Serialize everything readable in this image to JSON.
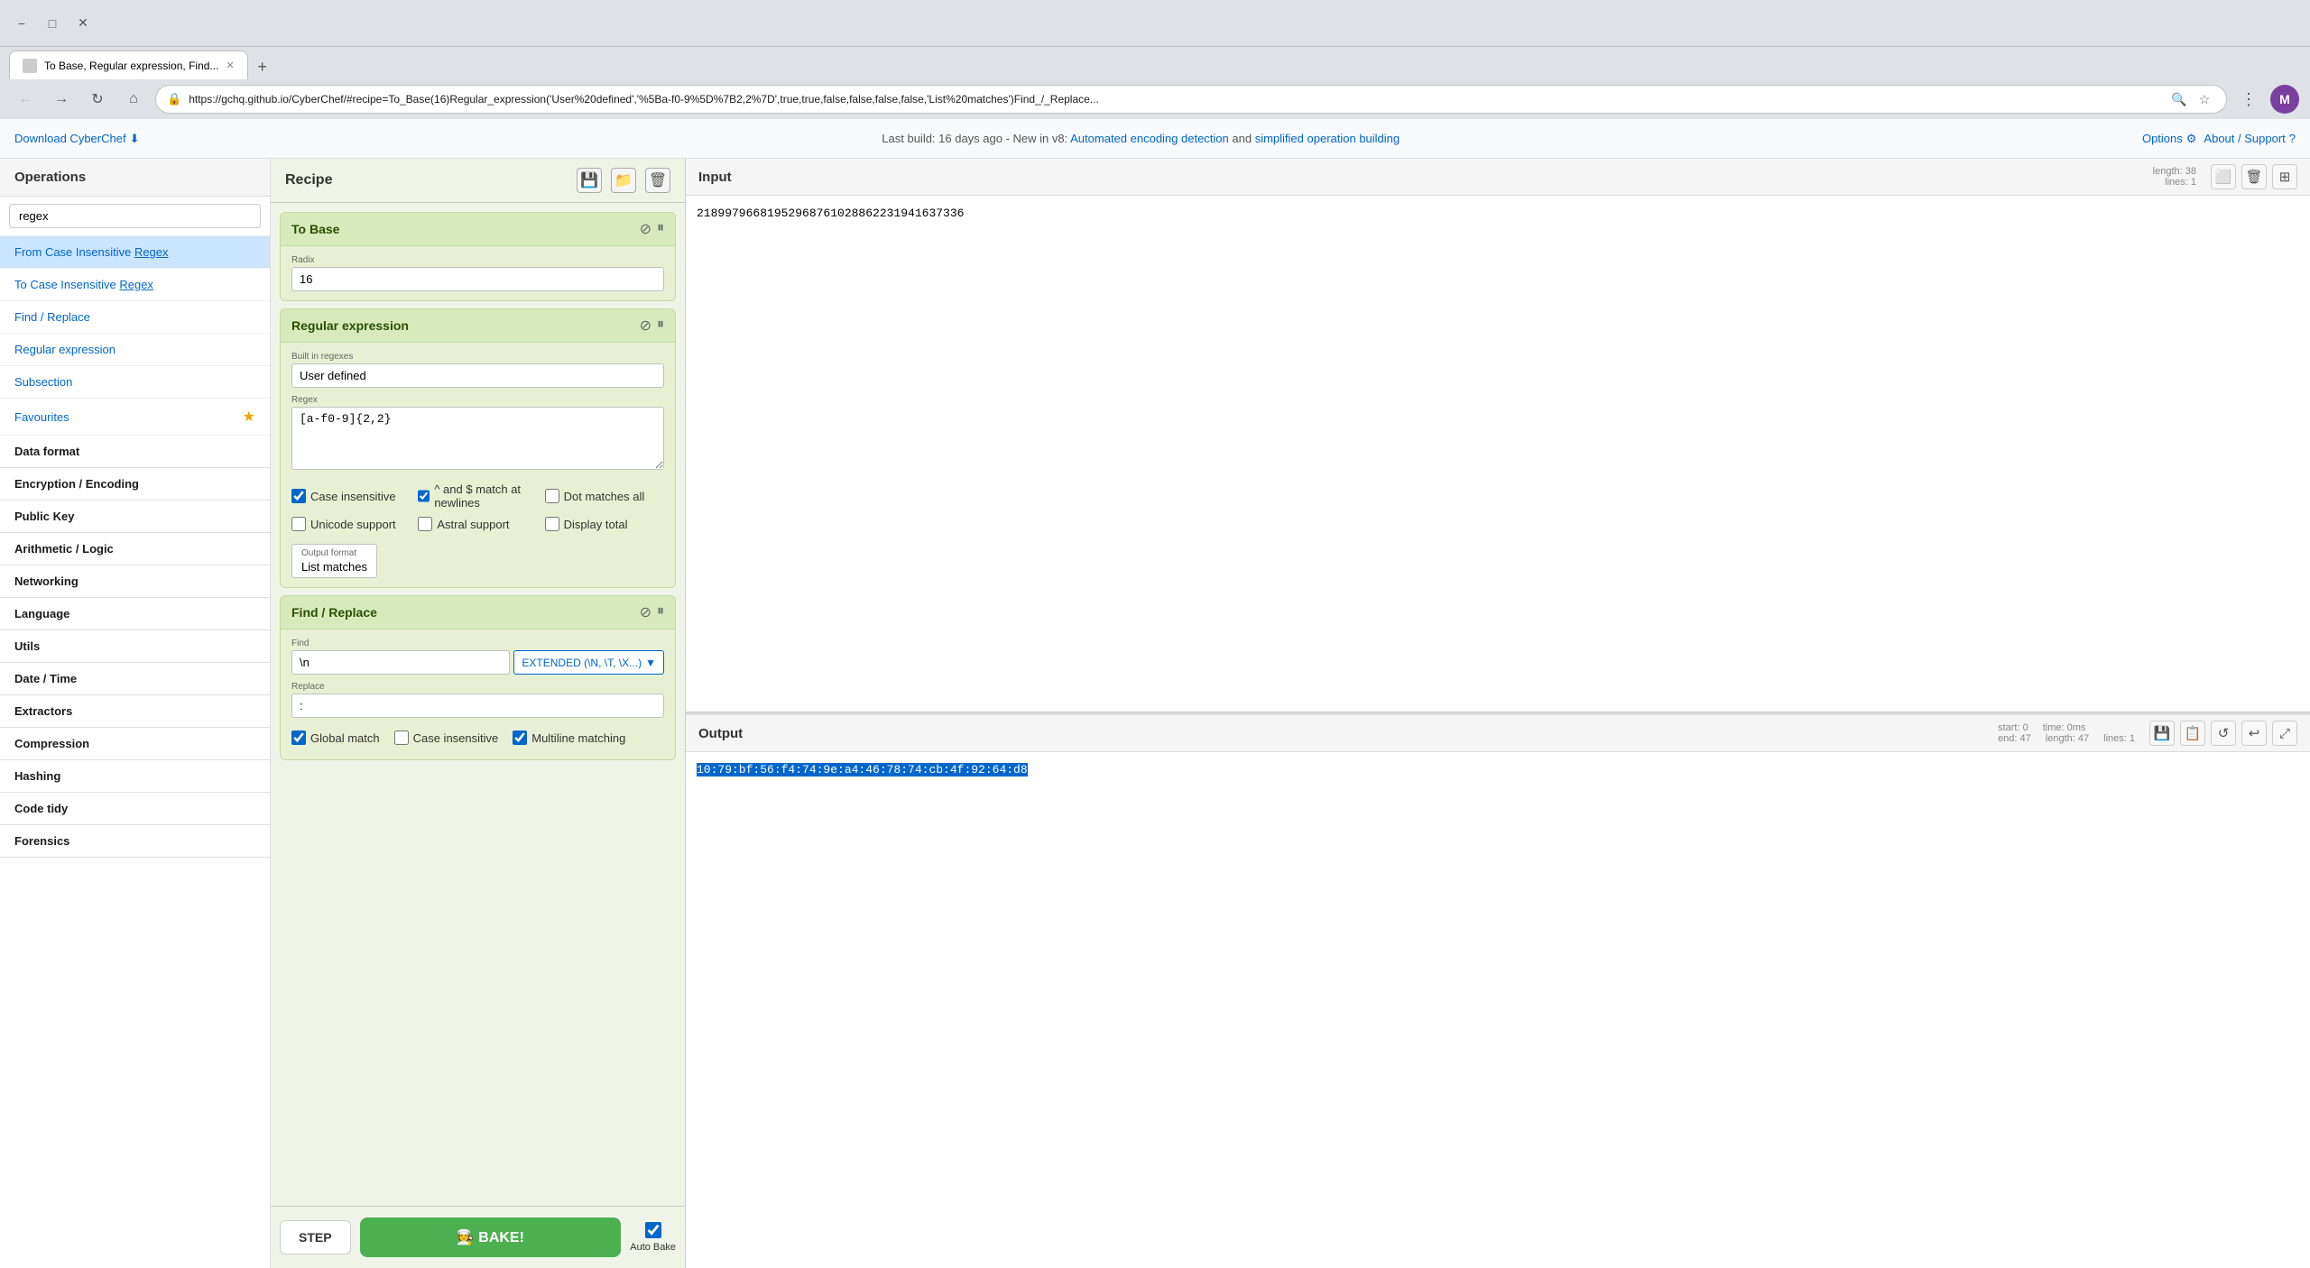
{
  "browser": {
    "tab_title": "To Base, Regular expression, Find...",
    "url": "https://gchq.github.io/CyberChef/#recipe=To_Base(16)Regular_expression('User%20defined','%5Ba-f0-9%5D%7B2,2%7D',true,true,false,false,false,false,'List%20matches')Find_/_Replace...",
    "nav_back_disabled": false,
    "nav_forward_disabled": false
  },
  "topbar": {
    "download_label": "Download CyberChef",
    "notification": "Last build: 16 days ago - New in v8: Automated encoding detection and simplified operation building",
    "notification_link": "Automated encoding detection",
    "notification_link2": "simplified operation building",
    "options_label": "Options",
    "about_label": "About / Support"
  },
  "sidebar": {
    "header": "Operations",
    "search_placeholder": "regex",
    "items": [
      {
        "id": "from-case-insensitive-regex",
        "text_before": "From Case Insensitive ",
        "text_link": "Regex",
        "active": true
      },
      {
        "id": "to-case-insensitive-regex",
        "text_before": "To Case Insensitive ",
        "text_link": "Regex"
      },
      {
        "id": "find-replace",
        "text": "Find / Replace"
      },
      {
        "id": "regular-expression",
        "text": "Regular expression"
      },
      {
        "id": "subsection",
        "text": "Subsection"
      },
      {
        "id": "favourites",
        "text": "Favourites"
      },
      {
        "id": "data-format",
        "text": "Data format"
      },
      {
        "id": "encryption-encoding",
        "text": "Encryption / Encoding"
      },
      {
        "id": "public-key",
        "text": "Public Key"
      },
      {
        "id": "arithmetic-logic",
        "text": "Arithmetic / Logic"
      },
      {
        "id": "networking",
        "text": "Networking"
      },
      {
        "id": "language",
        "text": "Language"
      },
      {
        "id": "utils",
        "text": "Utils"
      },
      {
        "id": "date-time",
        "text": "Date / Time"
      },
      {
        "id": "extractors",
        "text": "Extractors"
      },
      {
        "id": "compression",
        "text": "Compression"
      },
      {
        "id": "hashing",
        "text": "Hashing"
      },
      {
        "id": "code-tidy",
        "text": "Code tidy"
      },
      {
        "id": "forensics",
        "text": "Forensics"
      }
    ]
  },
  "recipe": {
    "title": "Recipe",
    "save_label": "💾",
    "load_label": "📁",
    "clear_label": "🗑️",
    "cards": [
      {
        "id": "to-base-card",
        "title": "To Base",
        "radix_label": "Radix",
        "radix_value": "16"
      },
      {
        "id": "regex-card",
        "title": "Regular expression",
        "builtin_label": "Built in regexes",
        "builtin_value": "User defined",
        "regex_label": "Regex",
        "regex_value": "[a-f0-9]{2,2}",
        "checkboxes": {
          "case_insensitive": {
            "label": "Case insensitive",
            "checked": true
          },
          "caret_dollar": {
            "label": "^ and $ match at newlines",
            "checked": true
          },
          "dot_matches_all": {
            "label": "Dot matches all",
            "checked": false
          },
          "unicode_support": {
            "label": "Unicode support",
            "checked": false
          },
          "astral_support": {
            "label": "Astral support",
            "checked": false
          },
          "display_total": {
            "label": "Display total",
            "checked": false
          }
        },
        "output_format_label": "Output format",
        "output_format_value": "List matches"
      },
      {
        "id": "find-replace-card",
        "title": "Find / Replace",
        "find_label": "Find",
        "find_value": "\\n",
        "find_type": "EXTENDED (\\N, \\T, \\X...)",
        "replace_label": "Replace",
        "replace_value": ":",
        "checkboxes": {
          "global_match": {
            "label": "Global match",
            "checked": true
          },
          "case_insensitive": {
            "label": "Case insensitive",
            "checked": false
          },
          "multiline_matching": {
            "label": "Multiline matching",
            "checked": true
          }
        }
      }
    ],
    "step_label": "STEP",
    "bake_label": "🧑‍🍳 BAKE!",
    "auto_bake_label": "Auto Bake",
    "auto_bake_checked": true
  },
  "input": {
    "title": "Input",
    "meta_length": "38",
    "meta_lines": "1",
    "value": "2189979668195296876102886223194163733​6"
  },
  "output": {
    "title": "Output",
    "meta_start": "0",
    "meta_end": "47",
    "meta_length": "47",
    "meta_lines": "1",
    "meta_time": "0ms",
    "value": "10:79:bf:56:f4:74:9e:a4:46:78:74:cb:4f:92:64:d8"
  }
}
